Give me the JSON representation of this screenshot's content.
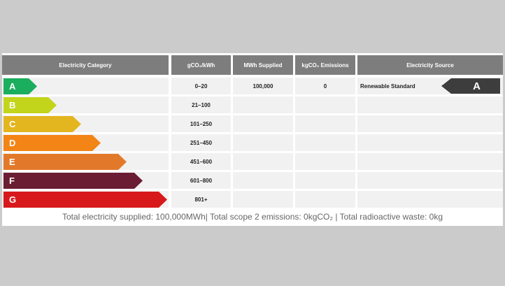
{
  "table": {
    "headers": [
      "Electricity Category",
      "gCO₂/kWh",
      "MWh Supplied",
      "kgCO₂ Emissions",
      "Electricity Source"
    ],
    "rows": [
      {
        "letter": "A",
        "range": "0–20",
        "mwh": "100,000",
        "emissions": "0",
        "source": "Renewable Standard",
        "badge": "A",
        "color": "#1aae5e"
      },
      {
        "letter": "B",
        "range": "21–100",
        "mwh": "",
        "emissions": "",
        "source": "",
        "badge": "",
        "color": "#c2d51a"
      },
      {
        "letter": "C",
        "range": "101–250",
        "mwh": "",
        "emissions": "",
        "source": "",
        "badge": "",
        "color": "#e3b51f"
      },
      {
        "letter": "D",
        "range": "251–450",
        "mwh": "",
        "emissions": "",
        "source": "",
        "badge": "",
        "color": "#f38416"
      },
      {
        "letter": "E",
        "range": "451–600",
        "mwh": "",
        "emissions": "",
        "source": "",
        "badge": "",
        "color": "#e2792a"
      },
      {
        "letter": "F",
        "range": "601–800",
        "mwh": "",
        "emissions": "",
        "source": "",
        "badge": "",
        "color": "#6b1d33"
      },
      {
        "letter": "G",
        "range": "801+",
        "mwh": "",
        "emissions": "",
        "source": "",
        "badge": "",
        "color": "#d8191b"
      }
    ]
  },
  "footer": {
    "text": "Total electricity supplied: 100,000MWh| Total scope 2 emissions: 0kgCO₂ | Total radioactive waste: 0kg"
  },
  "colors": {
    "header_bg": "#7d7d7d",
    "cell_bg": "#f1f1f1",
    "page_bg": "#cbcbcb",
    "badge_bg": "#3d3d3d"
  }
}
